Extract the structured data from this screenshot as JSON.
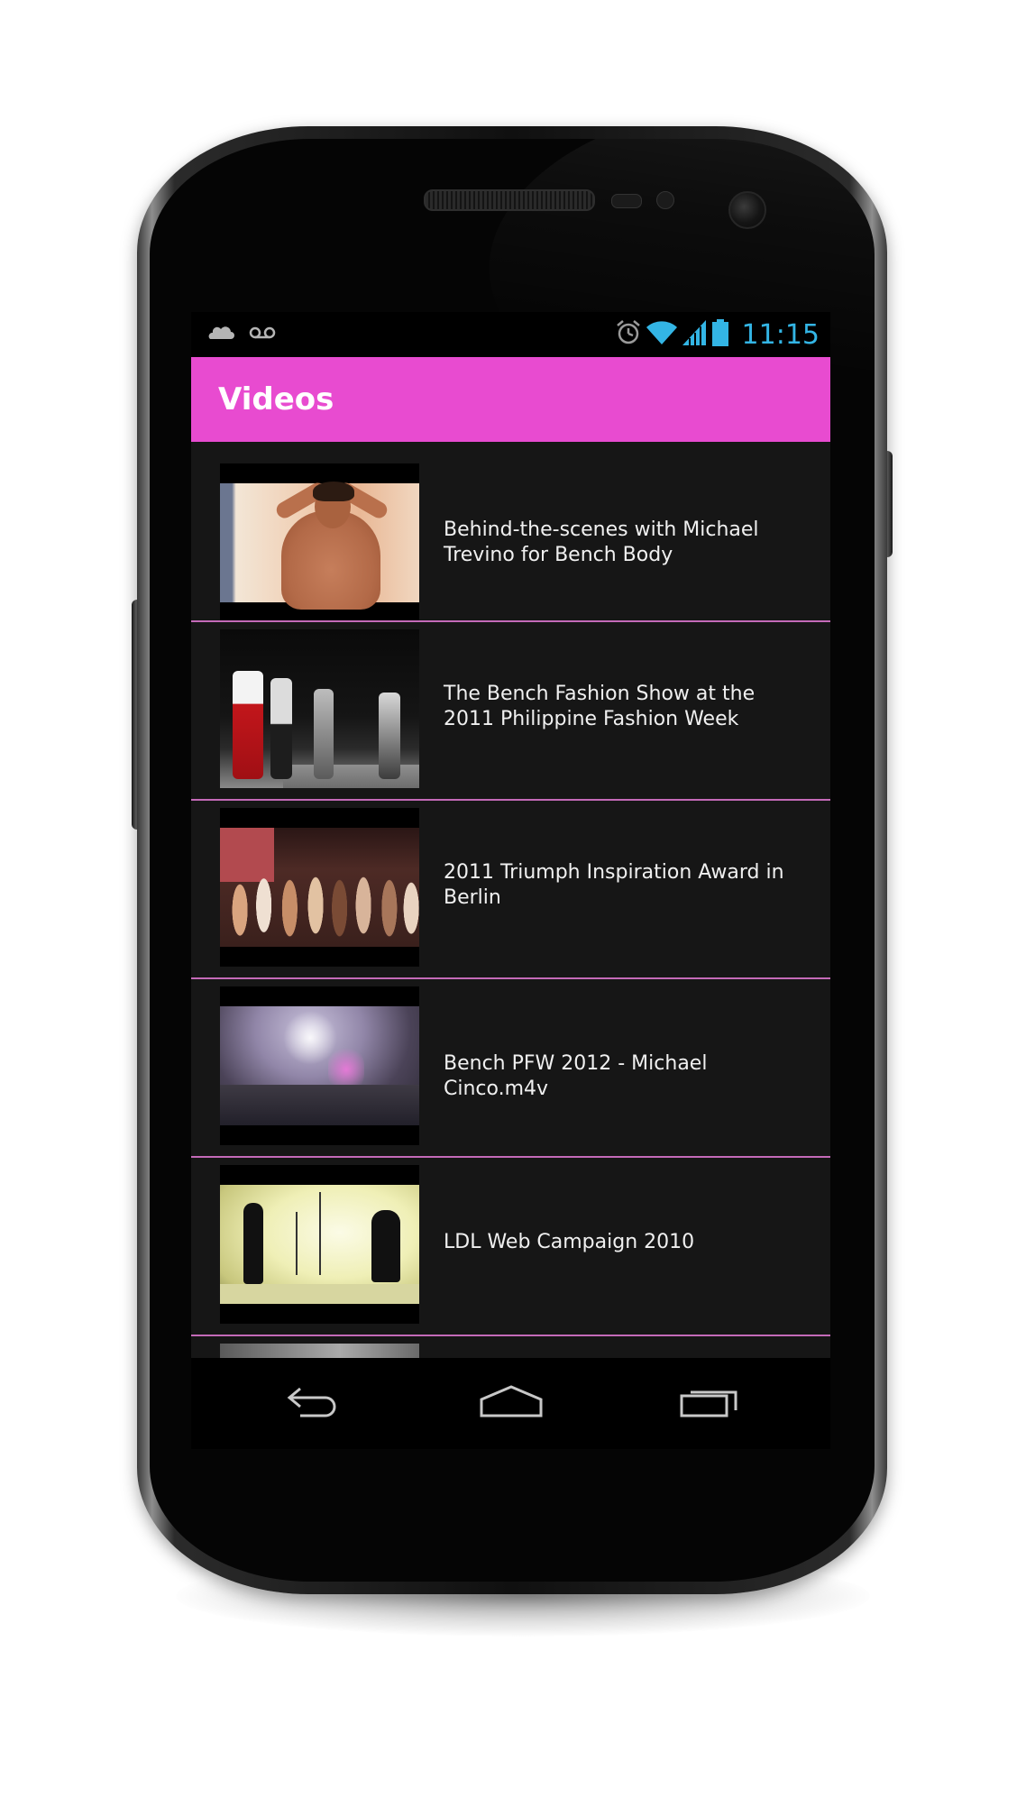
{
  "status_bar": {
    "time": "11:15",
    "left_icons": [
      "cloud-icon",
      "voicemail-icon"
    ],
    "right_icons": [
      "alarm-icon",
      "wifi-icon",
      "signal-icon",
      "battery-icon"
    ],
    "accent_color": "#33b5e5"
  },
  "action_bar": {
    "title": "Videos",
    "color": "#e84bd0"
  },
  "videos": [
    {
      "title": "Behind-the-scenes with Michael Trevino for Bench Body"
    },
    {
      "title": "The Bench Fashion Show at the 2011 Philippine Fashion Week"
    },
    {
      "title": "2011 Triumph Inspiration Award in Berlin"
    },
    {
      "title": "Bench PFW 2012 - Michael Cinco.m4v"
    },
    {
      "title": "LDL Web Campaign 2010"
    }
  ],
  "nav_bar": {
    "buttons": [
      "back-icon",
      "home-icon",
      "recent-apps-icon"
    ]
  },
  "colors": {
    "list_background": "#161616",
    "divider": "#c46ab8",
    "text": "#f0f0f0"
  }
}
